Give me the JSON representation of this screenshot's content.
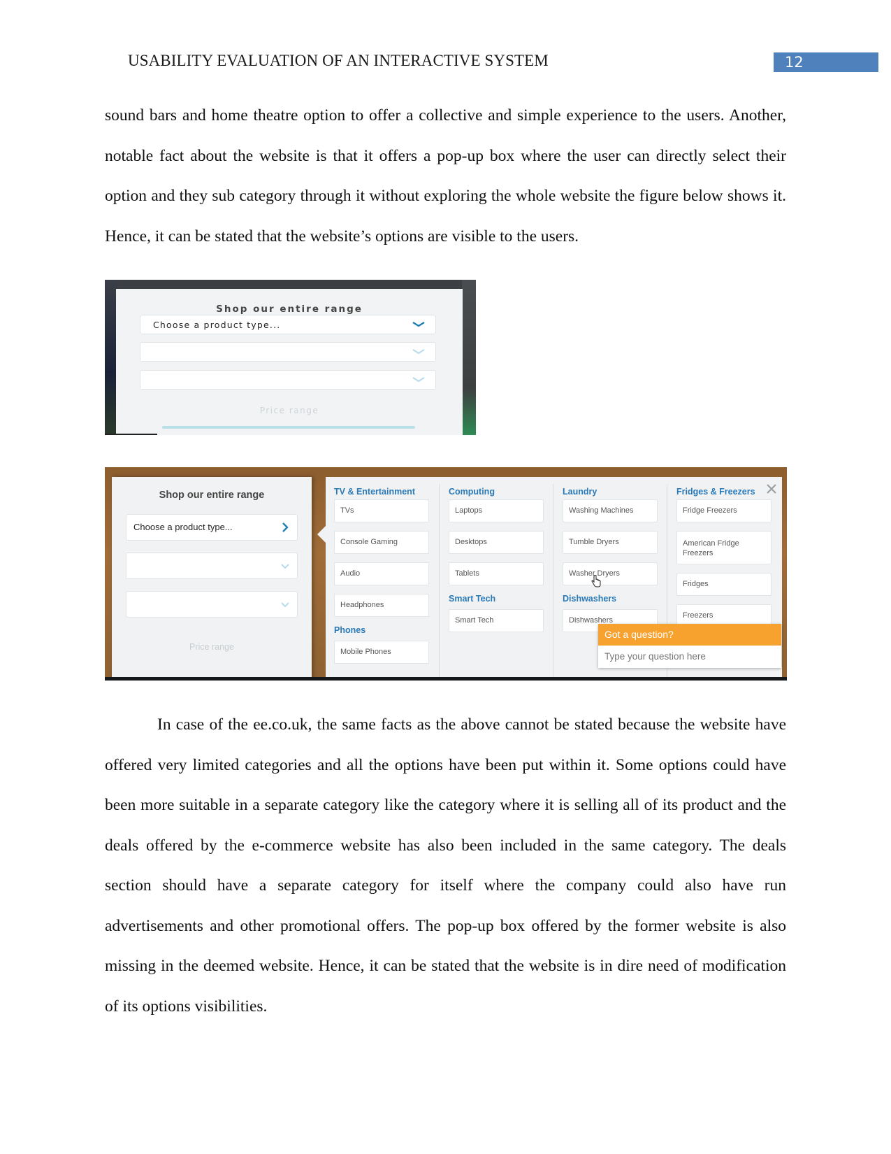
{
  "header": {
    "running_head": "USABILITY EVALUATION OF AN INTERACTIVE SYSTEM",
    "page_number": "12",
    "page_number_color": "#4f81bd"
  },
  "paragraphs": [
    "sound bars and home theatre option to offer a collective and simple experience to the users. Another, notable fact about the website is that it offers a pop-up box where the user can directly select their option and they sub category through it without exploring the whole website the figure below shows it. Hence, it can be stated that the website’s options are visible to the users.",
    "In case of the ee.co.uk, the same facts as the above cannot be stated because the website have offered very limited categories and all the options have been put within it. Some options could have been more suitable in a separate category like the category where it is selling all of its product and the deals offered by the e-commerce website has also been included in the same category. The deals section should have a separate category for itself where the company could also have run advertisements and other promotional offers. The pop-up box offered by the former website is also missing in the deemed website. Hence, it can be stated that the website is in dire need of modification of its options visibilities."
  ],
  "figure1": {
    "title": "Shop our entire range",
    "select_1_placeholder": "Choose a product type...",
    "select_2_placeholder": "",
    "select_3_placeholder": "",
    "price_label": "Price range",
    "icon": "chevron-down-icon"
  },
  "figure2": {
    "left_panel": {
      "title": "Shop our entire range",
      "select_1_value": "Choose a product type...",
      "select_2_value": "",
      "select_3_value": "",
      "price_label": "Price range",
      "select_1_icon": "chevron-right-icon"
    },
    "columns": [
      {
        "groups": [
          {
            "category": "TV & Entertainment",
            "items": [
              "TVs",
              "Console Gaming",
              "Audio",
              "Headphones"
            ]
          },
          {
            "category": "Phones",
            "items": [
              "Mobile Phones"
            ]
          }
        ]
      },
      {
        "groups": [
          {
            "category": "Computing",
            "items": [
              "Laptops",
              "Desktops",
              "Tablets"
            ]
          },
          {
            "category": "Smart Tech",
            "items": [
              "Smart Tech"
            ]
          }
        ]
      },
      {
        "groups": [
          {
            "category": "Laundry",
            "items": [
              "Washing Machines",
              "Tumble Dryers",
              "Washer Dryers"
            ]
          },
          {
            "category": "Dishwashers",
            "items": [
              "Dishwashers"
            ]
          }
        ]
      },
      {
        "groups": [
          {
            "category": "Fridges & Freezers",
            "items": [
              "Fridge Freezers",
              "American Fridge Freezers",
              "Fridges",
              "Freezers"
            ]
          }
        ]
      }
    ],
    "close_icon": "close-icon",
    "chat": {
      "title": "Got a question?",
      "placeholder": "Type your question here",
      "accent_color": "#f7a12e"
    },
    "category_color": "#2a7ab8"
  }
}
